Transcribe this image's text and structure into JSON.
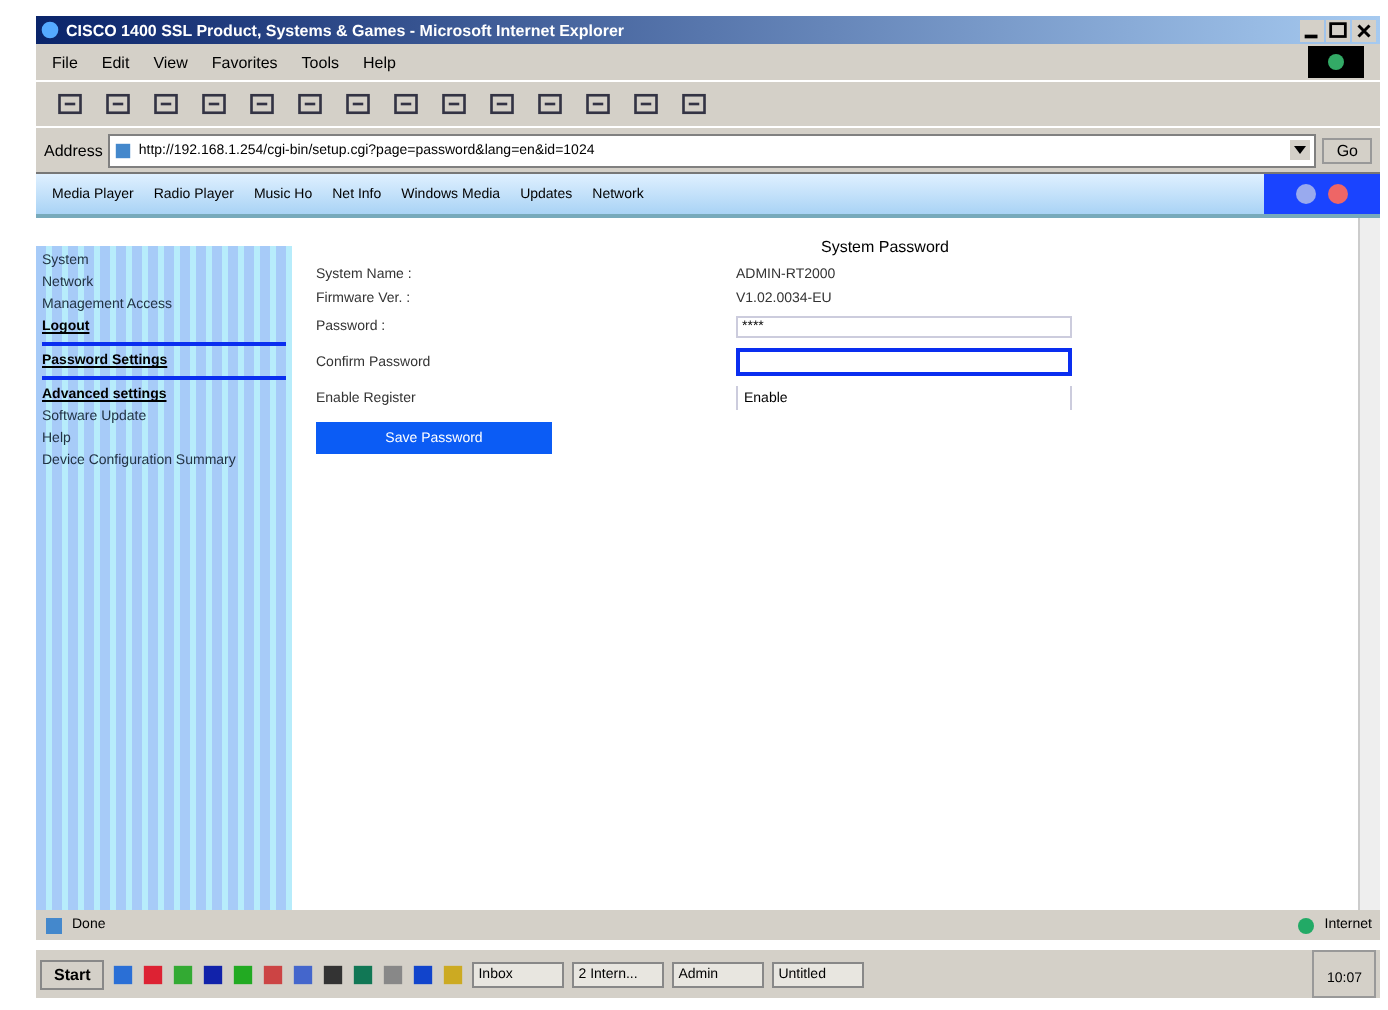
{
  "window": {
    "title": "CISCO 1400 SSL Product, Systems & Games - Microsoft Internet Explorer"
  },
  "menu": [
    "File",
    "Edit",
    "View",
    "Favorites",
    "Tools",
    "Help"
  ],
  "address_bar": {
    "label": "Address",
    "url": "http://192.168.1.254/cgi-bin/setup.cgi?page=password&lang=en&id=1024",
    "go": "Go"
  },
  "links": [
    "Media Player",
    "Radio Player",
    "Music Ho",
    "Net Info",
    "Windows Media",
    "Updates",
    "Network"
  ],
  "nav": [
    {
      "label": "System",
      "underlined": false
    },
    {
      "label": "Network",
      "underlined": false
    },
    {
      "label": "Management Access",
      "underlined": false
    },
    {
      "label": "Logout",
      "underlined": true,
      "rule_after": true
    },
    {
      "label": "Password Settings",
      "underlined": true,
      "rule_after": true
    },
    {
      "label": "Advanced settings",
      "underlined": true,
      "rule_after": false
    },
    {
      "label": "Software Update",
      "underlined": false
    },
    {
      "label": "Help",
      "underlined": false
    },
    {
      "label": "Device Configuration Summary",
      "underlined": false
    }
  ],
  "form": {
    "title": "System Password",
    "rows": [
      {
        "label": "System Name :",
        "kind": "text",
        "value": "ADMIN-RT2000"
      },
      {
        "label": "Firmware Ver. :",
        "kind": "text",
        "value": "V1.02.0034-EU"
      },
      {
        "label": "Password :",
        "kind": "input",
        "value": "****",
        "focused": false
      },
      {
        "label": "Confirm Password",
        "kind": "input",
        "value": "",
        "focused": true
      },
      {
        "label": "Enable Register",
        "kind": "select",
        "value": "Enable"
      }
    ],
    "button": "Save Password"
  },
  "status_bar": {
    "text": "Done",
    "zone": "Internet"
  },
  "taskbar": {
    "start": "Start",
    "tasks": [
      "Inbox",
      "2 Intern...",
      "Admin",
      "Untitled"
    ],
    "clock": "10:07"
  }
}
